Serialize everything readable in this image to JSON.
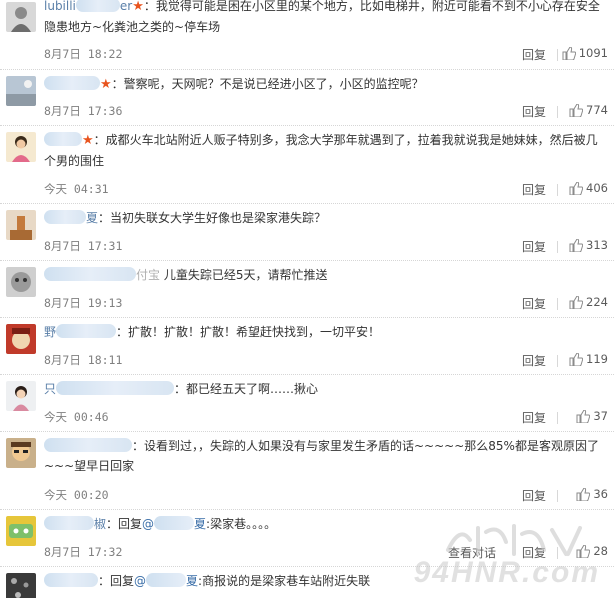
{
  "comments": [
    {
      "user_clear": "lubilli",
      "user_tail": "er",
      "text": "：我觉得可能是困在小区里的某个地方，比如电梯井，附近可能看不到不小心存在安全隐患地方~化粪池之类的~停车场",
      "time": "8月7日 18:22",
      "reply_label": "回复",
      "likes": "1091",
      "verified": true
    },
    {
      "user_clear": "",
      "user_tail": "",
      "text": "：警察呢，天网呢？不是说已经进小区了，小区的监控呢？",
      "time": "8月7日 17:36",
      "reply_label": "回复",
      "likes": "774",
      "verified": true
    },
    {
      "user_clear": "",
      "user_tail": "",
      "text": "：成都火车北站附近人贩子特别多，我念大学那年就遇到了，拉着我就说我是她妹妹，然后被几个男的围住",
      "time": "今天 04:31",
      "reply_label": "回复",
      "likes": "406",
      "verified": true
    },
    {
      "user_clear": "",
      "user_tail": "夏",
      "text": "：当初失联女大学生好像也是梁家港失踪？",
      "time": "8月7日 17:31",
      "reply_label": "回复",
      "likes": "313",
      "verified": false
    },
    {
      "user_clear": "",
      "user_tail": "付宝",
      "text": " 儿童失踪已经5天，请帮忙推送",
      "time": "8月7日 19:13",
      "reply_label": "回复",
      "likes": "224",
      "verified": false
    },
    {
      "user_clear": "野",
      "user_tail": "",
      "text": "：扩散！扩散！扩散！希望赶快找到，一切平安！",
      "time": "8月7日 18:11",
      "reply_label": "回复",
      "likes": "119",
      "verified": false
    },
    {
      "user_clear": "只",
      "user_tail": "",
      "text": "：都已经五天了啊……揪心",
      "time": "今天 00:46",
      "reply_label": "回复",
      "likes": "37",
      "verified": false
    },
    {
      "user_clear": "",
      "user_tail": "",
      "text": "：设看到过，，失踪的人如果没有与家里发生矛盾的话~~~~~那么85%都是客观原因了 ~~~望早日回家",
      "time": "今天 00:20",
      "reply_label": "回复",
      "likes": "36",
      "verified": false
    },
    {
      "user_clear": "",
      "user_tail": "椒",
      "text_prefix": "：回复",
      "reply_to": "@",
      "reply_to_tail": "夏",
      "text": ":梁家巷。。。。",
      "time": "8月7日 17:32",
      "reply_label": "查看对话",
      "reply_label2": "回复",
      "likes": "28",
      "verified": false
    },
    {
      "user_clear": "",
      "user_tail": "",
      "text_prefix": "：回复",
      "reply_to": "@",
      "reply_to_tail": "夏",
      "text": ":商报说的是梁家巷车站附近失联",
      "time": "",
      "reply_label": "",
      "likes": "",
      "verified": false
    }
  ],
  "watermark": {
    "text": "94HNR.com",
    "logo_text": "湖南人"
  },
  "colors": {
    "link": "#3a6ea8",
    "star": "#e8541e",
    "meta": "#808080"
  },
  "icons": {
    "like": "thumbs-up-icon",
    "verified": "star-icon"
  }
}
